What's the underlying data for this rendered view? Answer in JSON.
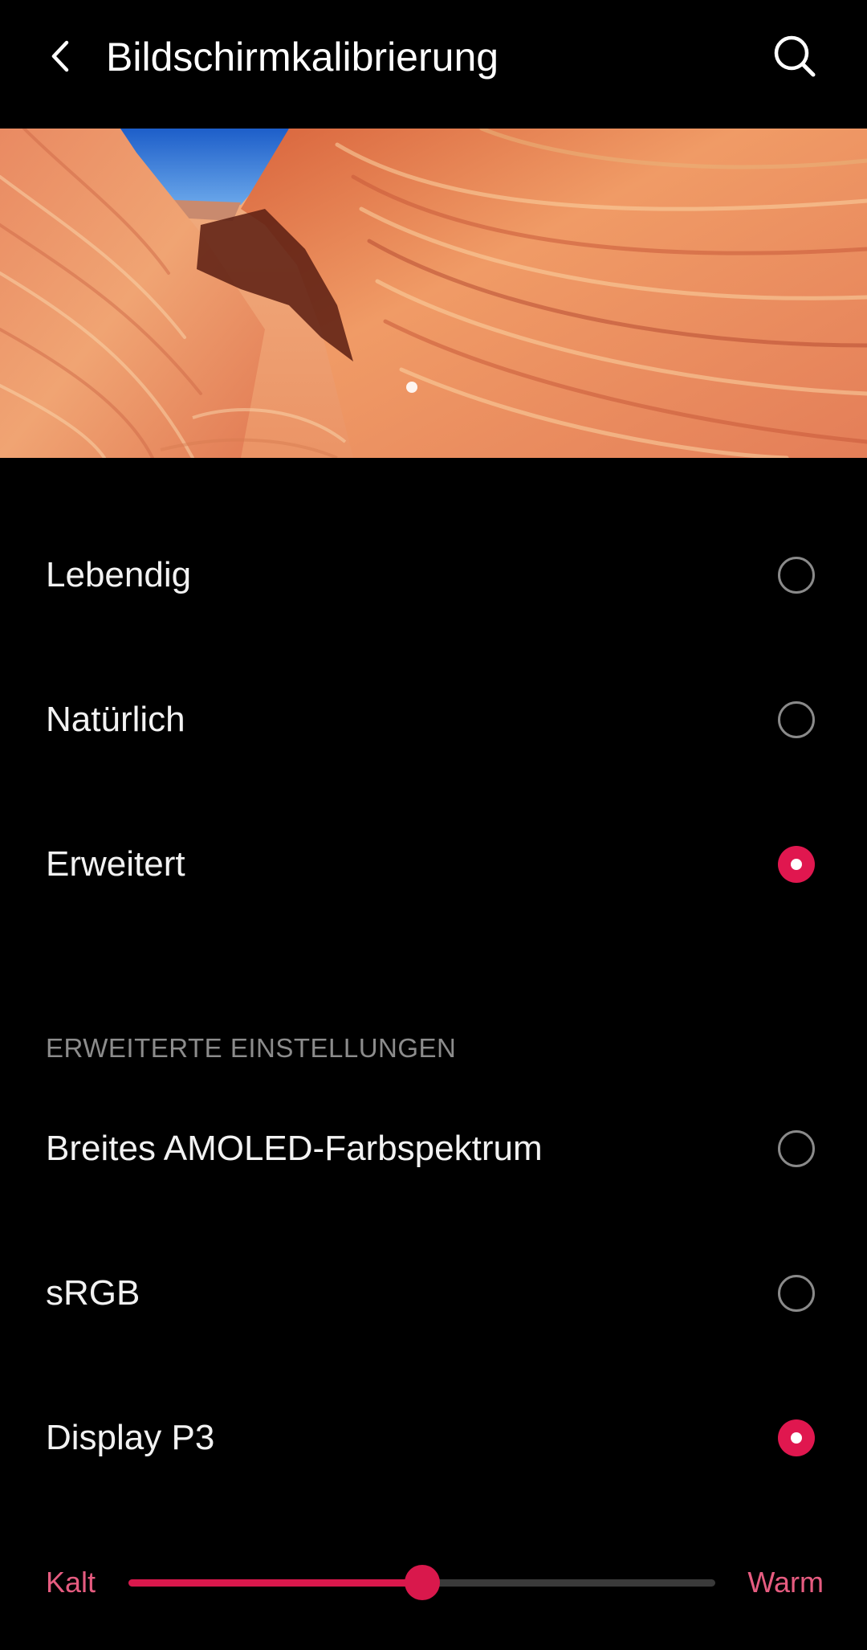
{
  "header": {
    "title": "Bildschirmkalibrierung",
    "back_icon": "chevron-left-icon",
    "search_icon": "search-icon"
  },
  "hero": {
    "image": "sandstone-wave-landscape",
    "page_count": 1,
    "current_page": 1
  },
  "modes": [
    {
      "label": "Lebendig",
      "selected": false
    },
    {
      "label": "Natürlich",
      "selected": false
    },
    {
      "label": "Erweitert",
      "selected": true
    }
  ],
  "advanced": {
    "header": "ERWEITERTE EINSTELLUNGEN",
    "options": [
      {
        "label": "Breites AMOLED-Farbspektrum",
        "selected": false
      },
      {
        "label": "sRGB",
        "selected": false
      },
      {
        "label": "Display P3",
        "selected": true
      }
    ]
  },
  "temperature": {
    "min_label": "Kalt",
    "max_label": "Warm",
    "value_fraction": 0.5
  },
  "colors": {
    "background": "#000000",
    "accent": "#d9184c",
    "slider_label": "#e65c80",
    "section_header": "#8c8c8c"
  }
}
